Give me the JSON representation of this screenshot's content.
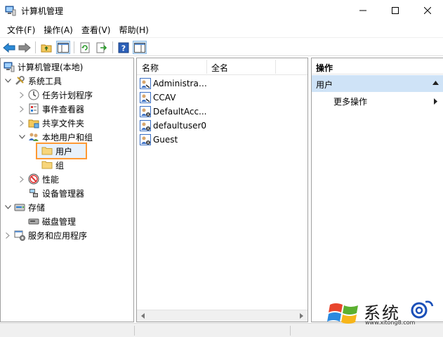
{
  "window": {
    "title": "计算机管理"
  },
  "menu": [
    "文件(F)",
    "操作(A)",
    "查看(V)",
    "帮助(H)"
  ],
  "tree": {
    "root": "计算机管理(本地)",
    "system_tools": "系统工具",
    "task_scheduler": "任务计划程序",
    "event_viewer": "事件查看器",
    "shared_folders": "共享文件夹",
    "local_users_groups": "本地用户和组",
    "users": "用户",
    "groups": "组",
    "performance": "性能",
    "device_manager": "设备管理器",
    "storage": "存储",
    "disk_management": "磁盘管理",
    "services_apps": "服务和应用程序"
  },
  "list": {
    "columns": [
      "名称",
      "全名"
    ],
    "rows": [
      "Administrat...",
      "CCAV",
      "DefaultAcc...",
      "defaultuser0",
      "Guest"
    ]
  },
  "actions": {
    "header": "操作",
    "section": "用户",
    "more": "更多操作"
  },
  "watermark": {
    "text": "系统",
    "url": "www.xitong8.com"
  },
  "colors": {
    "selection_outline": "#ff9933",
    "action_section_bg": "#cfe3f7",
    "accent": "#2a7fd4"
  }
}
